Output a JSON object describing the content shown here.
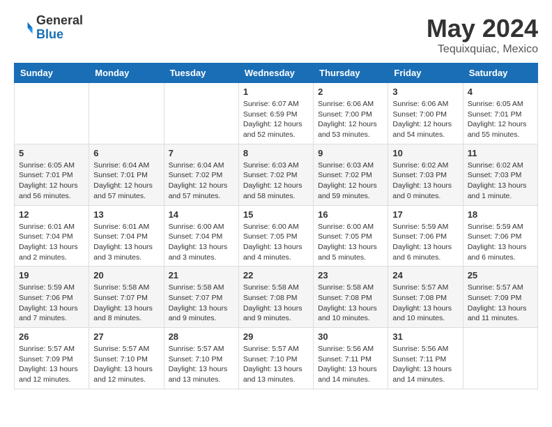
{
  "logo": {
    "general": "General",
    "blue": "Blue"
  },
  "title": {
    "month_year": "May 2024",
    "location": "Tequixquiac, Mexico"
  },
  "weekdays": [
    "Sunday",
    "Monday",
    "Tuesday",
    "Wednesday",
    "Thursday",
    "Friday",
    "Saturday"
  ],
  "weeks": [
    [
      {
        "day": "",
        "info": ""
      },
      {
        "day": "",
        "info": ""
      },
      {
        "day": "",
        "info": ""
      },
      {
        "day": "1",
        "info": "Sunrise: 6:07 AM\nSunset: 6:59 PM\nDaylight: 12 hours\nand 52 minutes."
      },
      {
        "day": "2",
        "info": "Sunrise: 6:06 AM\nSunset: 7:00 PM\nDaylight: 12 hours\nand 53 minutes."
      },
      {
        "day": "3",
        "info": "Sunrise: 6:06 AM\nSunset: 7:00 PM\nDaylight: 12 hours\nand 54 minutes."
      },
      {
        "day": "4",
        "info": "Sunrise: 6:05 AM\nSunset: 7:01 PM\nDaylight: 12 hours\nand 55 minutes."
      }
    ],
    [
      {
        "day": "5",
        "info": "Sunrise: 6:05 AM\nSunset: 7:01 PM\nDaylight: 12 hours\nand 56 minutes."
      },
      {
        "day": "6",
        "info": "Sunrise: 6:04 AM\nSunset: 7:01 PM\nDaylight: 12 hours\nand 57 minutes."
      },
      {
        "day": "7",
        "info": "Sunrise: 6:04 AM\nSunset: 7:02 PM\nDaylight: 12 hours\nand 57 minutes."
      },
      {
        "day": "8",
        "info": "Sunrise: 6:03 AM\nSunset: 7:02 PM\nDaylight: 12 hours\nand 58 minutes."
      },
      {
        "day": "9",
        "info": "Sunrise: 6:03 AM\nSunset: 7:02 PM\nDaylight: 12 hours\nand 59 minutes."
      },
      {
        "day": "10",
        "info": "Sunrise: 6:02 AM\nSunset: 7:03 PM\nDaylight: 13 hours\nand 0 minutes."
      },
      {
        "day": "11",
        "info": "Sunrise: 6:02 AM\nSunset: 7:03 PM\nDaylight: 13 hours\nand 1 minute."
      }
    ],
    [
      {
        "day": "12",
        "info": "Sunrise: 6:01 AM\nSunset: 7:04 PM\nDaylight: 13 hours\nand 2 minutes."
      },
      {
        "day": "13",
        "info": "Sunrise: 6:01 AM\nSunset: 7:04 PM\nDaylight: 13 hours\nand 3 minutes."
      },
      {
        "day": "14",
        "info": "Sunrise: 6:00 AM\nSunset: 7:04 PM\nDaylight: 13 hours\nand 3 minutes."
      },
      {
        "day": "15",
        "info": "Sunrise: 6:00 AM\nSunset: 7:05 PM\nDaylight: 13 hours\nand 4 minutes."
      },
      {
        "day": "16",
        "info": "Sunrise: 6:00 AM\nSunset: 7:05 PM\nDaylight: 13 hours\nand 5 minutes."
      },
      {
        "day": "17",
        "info": "Sunrise: 5:59 AM\nSunset: 7:06 PM\nDaylight: 13 hours\nand 6 minutes."
      },
      {
        "day": "18",
        "info": "Sunrise: 5:59 AM\nSunset: 7:06 PM\nDaylight: 13 hours\nand 6 minutes."
      }
    ],
    [
      {
        "day": "19",
        "info": "Sunrise: 5:59 AM\nSunset: 7:06 PM\nDaylight: 13 hours\nand 7 minutes."
      },
      {
        "day": "20",
        "info": "Sunrise: 5:58 AM\nSunset: 7:07 PM\nDaylight: 13 hours\nand 8 minutes."
      },
      {
        "day": "21",
        "info": "Sunrise: 5:58 AM\nSunset: 7:07 PM\nDaylight: 13 hours\nand 9 minutes."
      },
      {
        "day": "22",
        "info": "Sunrise: 5:58 AM\nSunset: 7:08 PM\nDaylight: 13 hours\nand 9 minutes."
      },
      {
        "day": "23",
        "info": "Sunrise: 5:58 AM\nSunset: 7:08 PM\nDaylight: 13 hours\nand 10 minutes."
      },
      {
        "day": "24",
        "info": "Sunrise: 5:57 AM\nSunset: 7:08 PM\nDaylight: 13 hours\nand 10 minutes."
      },
      {
        "day": "25",
        "info": "Sunrise: 5:57 AM\nSunset: 7:09 PM\nDaylight: 13 hours\nand 11 minutes."
      }
    ],
    [
      {
        "day": "26",
        "info": "Sunrise: 5:57 AM\nSunset: 7:09 PM\nDaylight: 13 hours\nand 12 minutes."
      },
      {
        "day": "27",
        "info": "Sunrise: 5:57 AM\nSunset: 7:10 PM\nDaylight: 13 hours\nand 12 minutes."
      },
      {
        "day": "28",
        "info": "Sunrise: 5:57 AM\nSunset: 7:10 PM\nDaylight: 13 hours\nand 13 minutes."
      },
      {
        "day": "29",
        "info": "Sunrise: 5:57 AM\nSunset: 7:10 PM\nDaylight: 13 hours\nand 13 minutes."
      },
      {
        "day": "30",
        "info": "Sunrise: 5:56 AM\nSunset: 7:11 PM\nDaylight: 13 hours\nand 14 minutes."
      },
      {
        "day": "31",
        "info": "Sunrise: 5:56 AM\nSunset: 7:11 PM\nDaylight: 13 hours\nand 14 minutes."
      },
      {
        "day": "",
        "info": ""
      }
    ]
  ]
}
